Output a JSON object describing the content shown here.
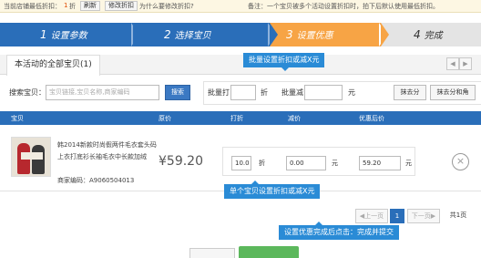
{
  "topbar": {
    "lowest_discount_prefix": "当前店铺最低折扣：",
    "lowest_discount_value": "1",
    "lowest_discount_unit": "折",
    "refresh": "刷新",
    "modify_discount": "修改折扣",
    "why_modify": "为什么要修改折扣?",
    "note": "备注：一个宝贝被多个活动设置折扣时，拍下后默认使用最低折扣。"
  },
  "steps": [
    {
      "num": "1",
      "label": "设置参数"
    },
    {
      "num": "2",
      "label": "选择宝贝"
    },
    {
      "num": "3",
      "label": "设置优惠"
    },
    {
      "num": "4",
      "label": "完成"
    }
  ],
  "tab": {
    "label": "本活动的全部宝贝(1)"
  },
  "callouts": {
    "batch": "批量设置折扣或减X元",
    "single": "单个宝贝设置折扣或减X元",
    "finish": "设置优惠完成后点击：完成并提交"
  },
  "search": {
    "label": "搜索宝贝：",
    "placeholder": "宝贝链接,宝贝名称,商家编码",
    "button": "搜索"
  },
  "batch": {
    "discount_label": "批量打",
    "discount_unit": "折",
    "minus_label": "批量减",
    "minus_unit": "元",
    "remove_decimal": "抹去分",
    "remove_jiao_fen": "抹去分和角"
  },
  "table": {
    "headers": [
      "宝贝",
      "原价",
      "打折",
      "减价",
      "优惠后价"
    ]
  },
  "product": {
    "title_line1": "韩2014新款时尚假两件毛衣套头码",
    "title_line2": "上衣打底衫长袖毛衣中长款加绒",
    "merchant_code": "商家编码：A9060504013",
    "price": "¥59.20",
    "discount_value": "10.0",
    "discount_unit": "折",
    "minus_value": "0.00",
    "minus_unit": "元",
    "final_value": "59.20",
    "final_unit": "元",
    "remove_symbol": "×"
  },
  "pager": {
    "prev": "◀上一页",
    "current": "1",
    "next": "下一页▶",
    "total": "共1页"
  },
  "icons": {
    "prev_arrow": "◀",
    "next_arrow": "▶"
  },
  "colors": {
    "primary_blue": "#2a6eb9",
    "active_orange": "#f7a445",
    "callout_blue": "#2a8bd6",
    "submit_green": "#5cb85c"
  }
}
